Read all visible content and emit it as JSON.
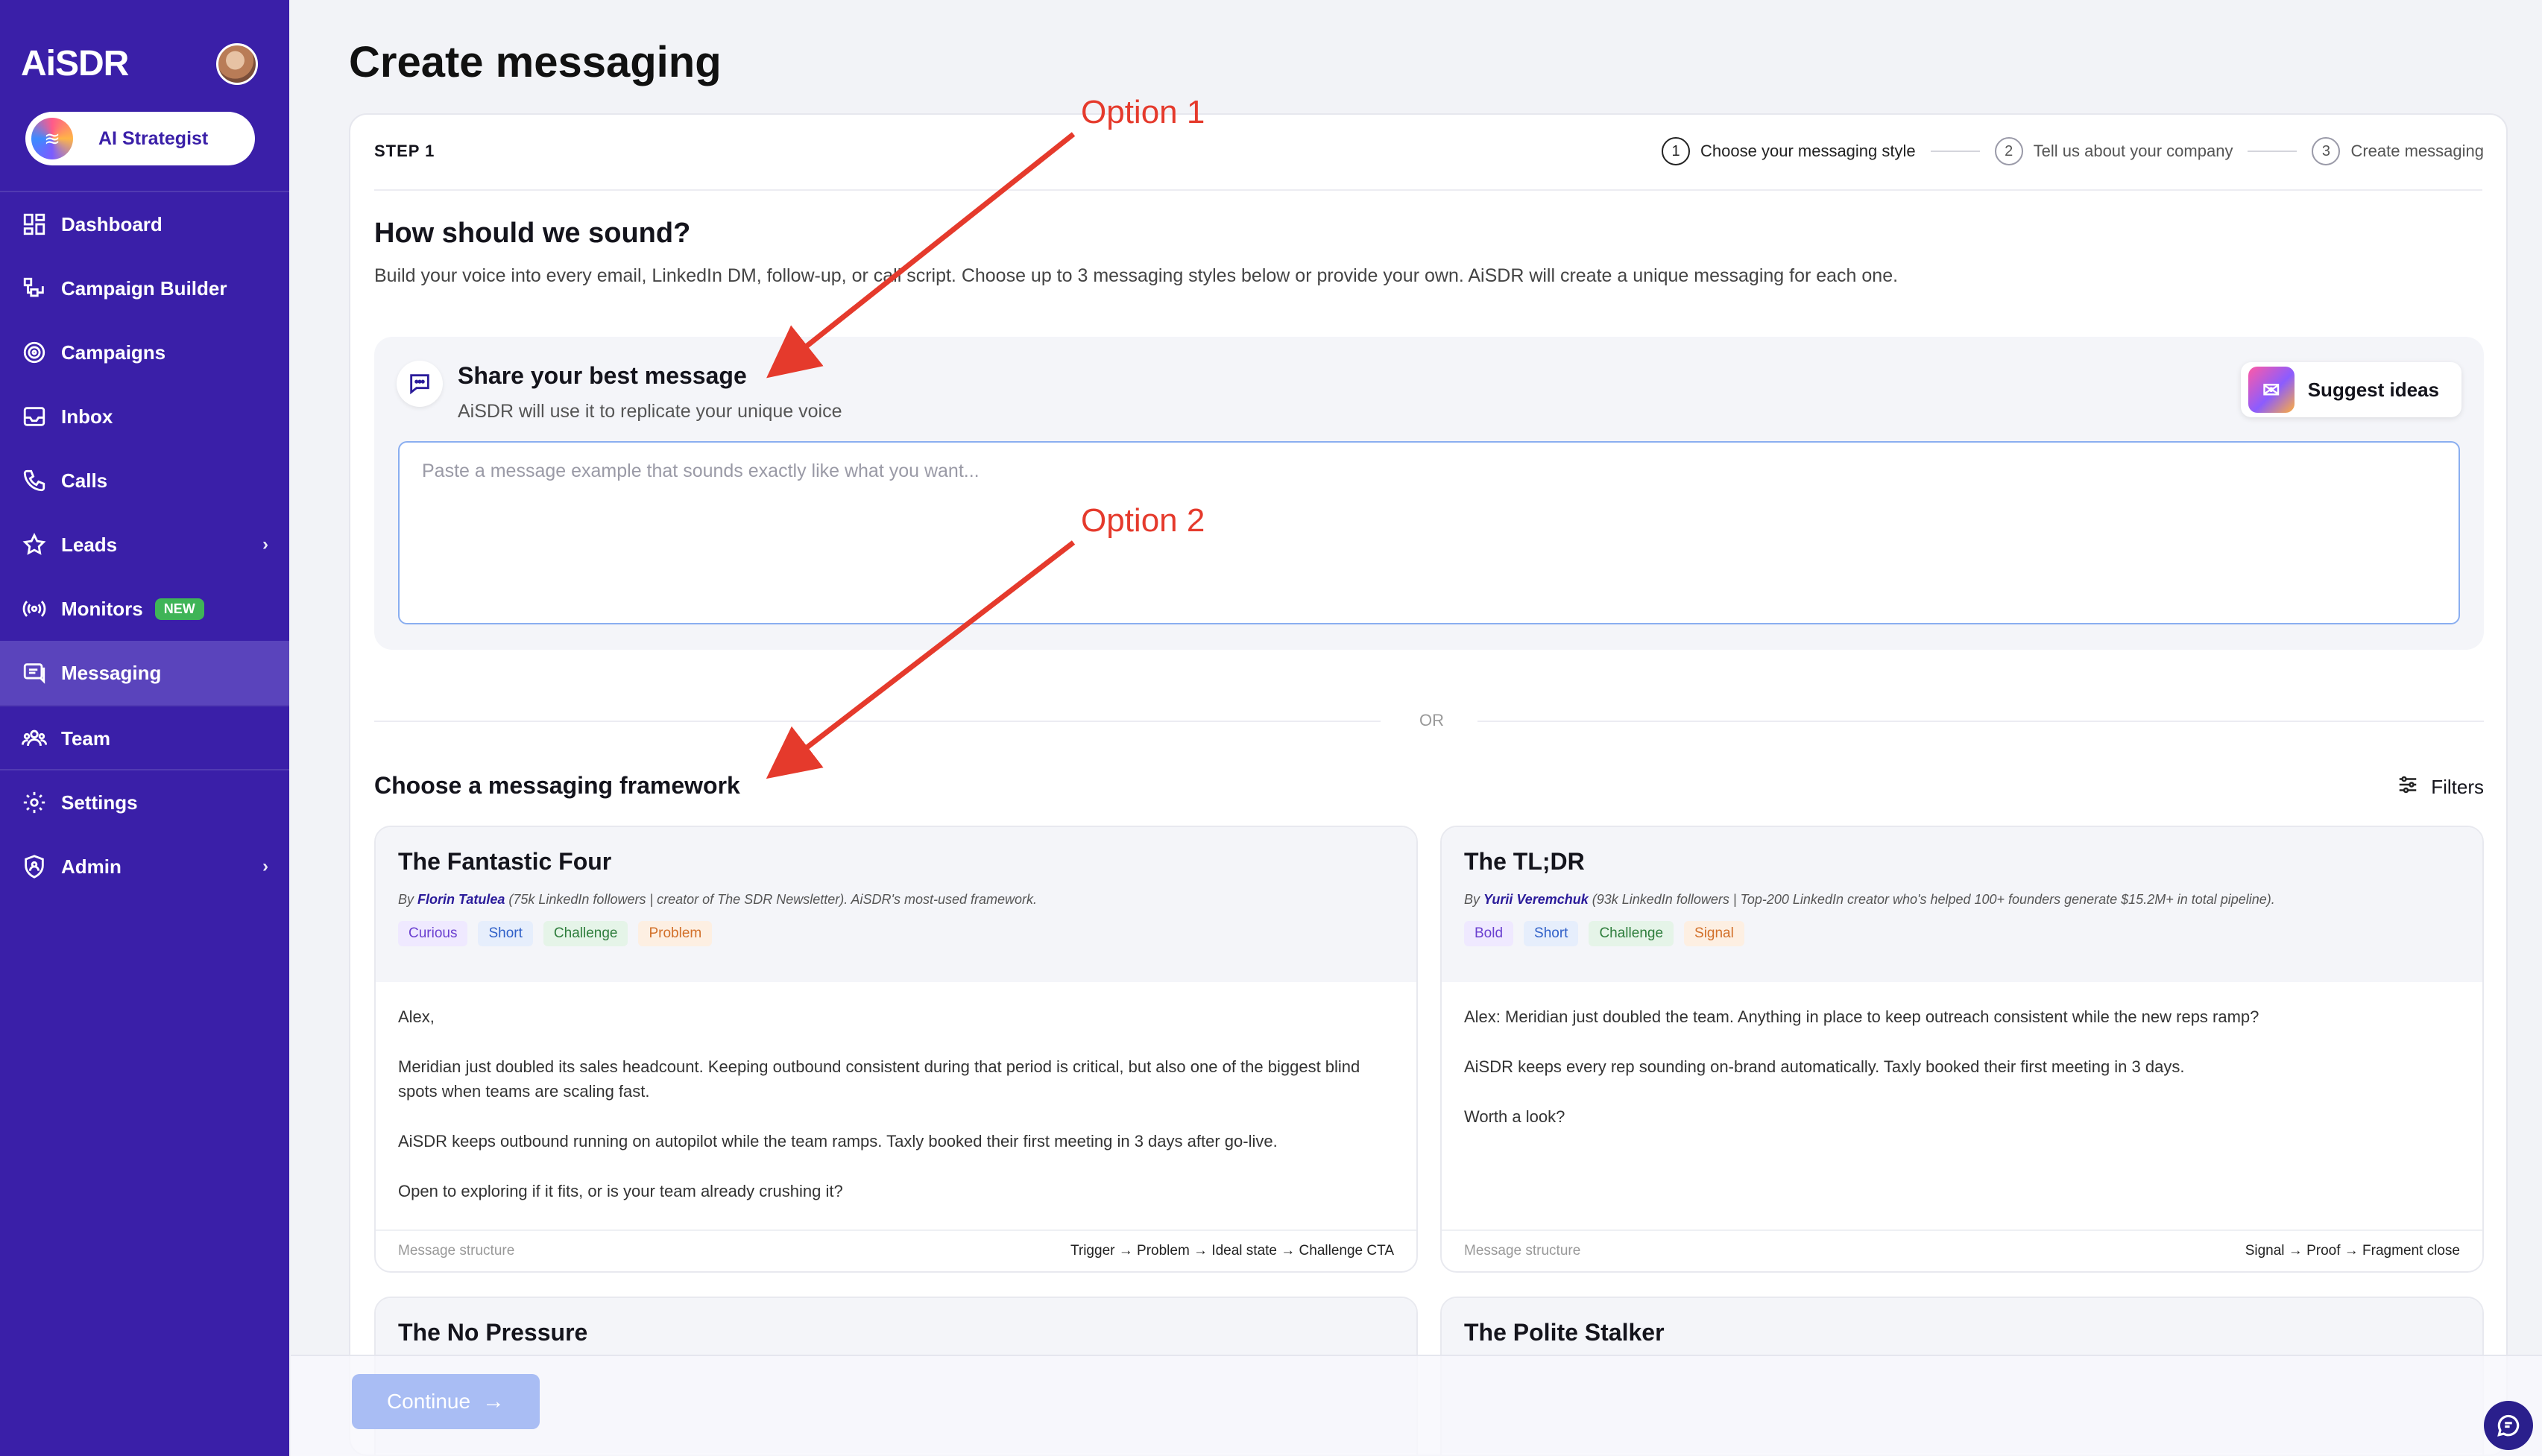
{
  "app": {
    "name": "AiSDR"
  },
  "sidebar": {
    "strategist_label": "AI Strategist",
    "items": [
      {
        "label": "Dashboard",
        "icon": "dashboard-icon"
      },
      {
        "label": "Campaign Builder",
        "icon": "campaign-builder-icon"
      },
      {
        "label": "Campaigns",
        "icon": "target-icon"
      },
      {
        "label": "Inbox",
        "icon": "inbox-icon"
      },
      {
        "label": "Calls",
        "icon": "phone-icon"
      },
      {
        "label": "Leads",
        "icon": "star-icon",
        "chevron": "›"
      },
      {
        "label": "Monitors",
        "icon": "broadcast-icon",
        "badge": "NEW"
      },
      {
        "label": "Messaging",
        "icon": "message-icon",
        "active": true
      },
      {
        "label": "Team",
        "icon": "team-icon"
      },
      {
        "label": "Settings",
        "icon": "gear-icon"
      },
      {
        "label": "Admin",
        "icon": "shield-icon",
        "chevron": "›"
      }
    ]
  },
  "page": {
    "title": "Create messaging"
  },
  "wizard": {
    "step_label": "STEP 1",
    "steps": [
      {
        "num": "1",
        "label": "Choose your messaging style",
        "active": true
      },
      {
        "num": "2",
        "label": "Tell us about your company"
      },
      {
        "num": "3",
        "label": "Create messaging"
      }
    ]
  },
  "intro": {
    "heading": "How should we sound?",
    "subtext": "Build your voice into every email, LinkedIn DM, follow-up, or call script. Choose up to 3 messaging styles below or provide your own. AiSDR will create a unique messaging for each one."
  },
  "share": {
    "title": "Share your best message",
    "subtitle": "AiSDR will use it to replicate your unique voice",
    "suggest_label": "Suggest ideas",
    "placeholder": "Paste a message example that sounds exactly like what you want..."
  },
  "or_label": "OR",
  "frameworks": {
    "title": "Choose a messaging framework",
    "filters_label": "Filters",
    "cards": [
      {
        "name": "The Fantastic Four",
        "by_prefix": "By ",
        "author": "Florin Tatulea",
        "by_rest": " (75k LinkedIn followers | creator of The SDR Newsletter). AiSDR's most-used framework.",
        "tags": [
          "Curious",
          "Short",
          "Challenge",
          "Problem"
        ],
        "body": [
          "Alex,",
          "Meridian just doubled its sales headcount. Keeping outbound consistent during that period is critical, but also one of the biggest blind spots when teams are scaling fast.",
          "AiSDR keeps outbound running on autopilot while the team ramps. Taxly booked their first meeting in 3 days after go-live.",
          "Open to exploring if it fits, or is your team already crushing it?"
        ],
        "structure_label": "Message structure",
        "structure": "Trigger → Problem → Ideal state → Challenge CTA"
      },
      {
        "name": "The TL;DR",
        "by_prefix": "By ",
        "author": "Yurii Veremchuk",
        "by_rest": " (93k LinkedIn followers | Top-200 LinkedIn creator who's helped 100+ founders generate $15.2M+ in total pipeline).",
        "tags": [
          "Bold",
          "Short",
          "Challenge",
          "Signal"
        ],
        "body": [
          "Alex: Meridian just doubled the team. Anything in place to keep outreach consistent while the new reps ramp?",
          "AiSDR keeps every rep sounding on-brand automatically. Taxly booked their first meeting in 3 days.",
          "Worth a look?"
        ],
        "structure_label": "Message structure",
        "structure": "Signal → Proof → Fragment close"
      },
      {
        "name": "The No Pressure"
      },
      {
        "name": "The Polite Stalker"
      }
    ]
  },
  "footer": {
    "continue_label": "Continue"
  },
  "annotations": {
    "option1": "Option 1",
    "option2": "Option 2"
  },
  "colors": {
    "sidebar": "#3a1fa8",
    "active_nav": "#5a44bc",
    "annotation": "#e53a2c",
    "continue": "#a9bdf4"
  }
}
